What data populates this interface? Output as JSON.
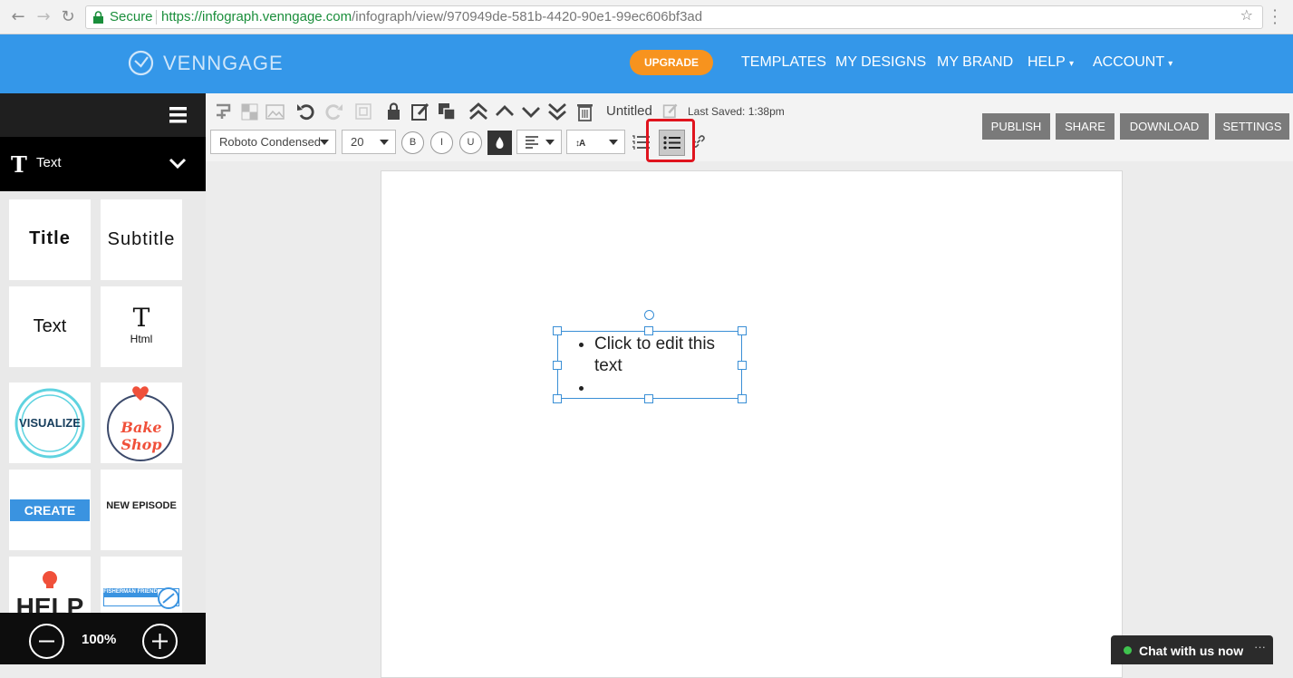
{
  "browser": {
    "secure_label": "Secure",
    "url_host": "https://infograph.venngage.com",
    "url_path": "/infograph/view/970949de-581b-4420-90e1-99ec606bf3ad"
  },
  "topnav": {
    "brand": "VENNGAGE",
    "upgrade_label": "UPGRADE",
    "links": [
      "TEMPLATES",
      "MY DESIGNS",
      "MY BRAND",
      "HELP",
      "ACCOUNT"
    ]
  },
  "sidebar": {
    "category_label": "Text",
    "tiles": [
      "Title",
      "Subtitle",
      "Text",
      "Html",
      "VISUALIZE",
      "Bake Shop",
      "CREATE",
      "NEW EPISODE",
      "HELP",
      "FISHERMAN FRIEND"
    ],
    "zoom": "100%"
  },
  "toolbar": {
    "doc_title": "Untitled",
    "last_saved": "Last Saved: 1:38pm",
    "font_family": "Roboto Condensed",
    "font_size": "20",
    "bold": "B",
    "italic": "I",
    "underline": "U",
    "actions": [
      "PUBLISH",
      "SHARE",
      "DOWNLOAD",
      "SETTINGS"
    ]
  },
  "canvas": {
    "bullet_text": "Click to edit this text"
  },
  "chat": {
    "label": "Chat with us now",
    "more": "···"
  },
  "colors": {
    "nav_blue": "#3497e9",
    "upgrade_orange": "#f7931e",
    "highlight_red": "#e0141e",
    "selection_blue": "#3a8fd6"
  }
}
